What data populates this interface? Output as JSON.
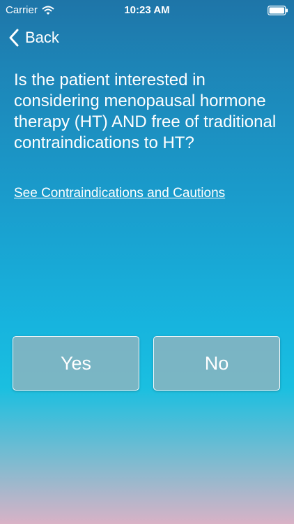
{
  "status_bar": {
    "carrier": "Carrier",
    "time": "10:23 AM",
    "wifi_icon": "wifi-icon",
    "battery_icon": "battery-icon"
  },
  "nav": {
    "back_label": "Back",
    "back_icon": "chevron-left-icon"
  },
  "question": "Is the patient interested in considering menopausal hormone therapy (HT) AND free of traditional contraindications to HT?",
  "link_text": "See Contraindications and Cautions",
  "answers": {
    "yes": "Yes",
    "no": "No"
  },
  "colors": {
    "gradient_top": "#1e75a8",
    "gradient_mid": "#17b4de",
    "gradient_bottom": "#d9b2c6",
    "button_fill": "#96b4bc",
    "text": "#ffffff"
  }
}
